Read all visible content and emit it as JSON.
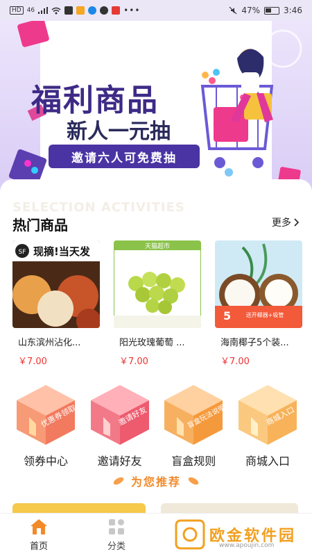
{
  "status": {
    "battery_pct": "47%",
    "time": "3:46",
    "signal": "46"
  },
  "banner": {
    "title": "福利商品",
    "subtitle": "新人一元抽",
    "cta": "邀请六人可免费抽"
  },
  "section": {
    "ghost_text": "SELECTION ACTIVITIES",
    "title": "热门商品",
    "more": "更多"
  },
  "products": [
    {
      "name": "山东滨州沾化...",
      "price": "￥7.00",
      "badge": "现摘!当天发"
    },
    {
      "name": "阳光玫瑰葡萄 ...",
      "price": "￥7.00",
      "badge": "天猫超市"
    },
    {
      "name": "海南椰子5个装...",
      "price": "￥7.00",
      "badge": "送开椰器+吸管"
    }
  ],
  "entries": [
    {
      "label": "领券中心",
      "box_text": "优惠券领取",
      "color": "#f27a5e"
    },
    {
      "label": "邀请好友",
      "box_text": "邀请好友",
      "color": "#ee5a6e"
    },
    {
      "label": "盲盒规则",
      "box_text": "盲盒玩法说明",
      "color": "#f59a3c"
    },
    {
      "label": "商城入口",
      "box_text": "商城入口",
      "color": "#f7b25a"
    }
  ],
  "recommend_title": "为您推荐",
  "tabs": [
    {
      "label": "首页",
      "active": true
    },
    {
      "label": "分类",
      "active": false
    }
  ],
  "watermark": {
    "text": "欧金软件园",
    "url": "www.apoujin.com"
  },
  "colors": {
    "accent": "#f28a2a",
    "price": "#ee3333",
    "banner_purple": "#4a34a3"
  }
}
